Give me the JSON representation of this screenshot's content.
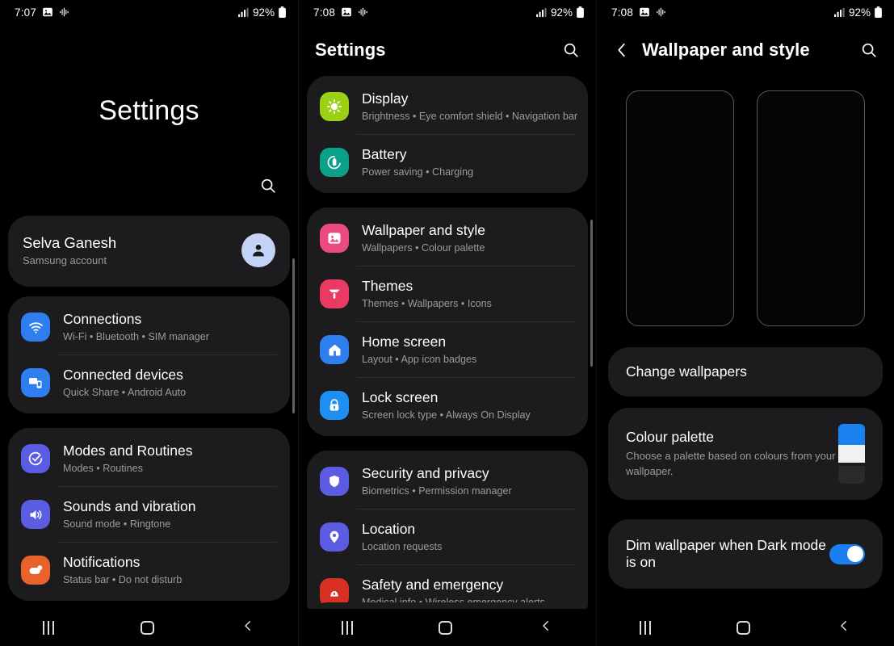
{
  "panels": {
    "one": {
      "status": {
        "time": "7:07",
        "battery": "92%",
        "icons": [
          "image-icon",
          "audio-wave-icon",
          "signal-bars-icon",
          "battery-icon"
        ]
      },
      "title": "Settings",
      "search_icon": "search-icon",
      "account": {
        "name": "Selva Ganesh",
        "subtitle": "Samsung account",
        "avatar": "person-avatar-icon"
      },
      "groups": [
        {
          "items": [
            {
              "title": "Connections",
              "subtitle": "Wi-Fi  •  Bluetooth  •  SIM manager",
              "icon": "wifi-icon",
              "color": "#2f7ef0"
            },
            {
              "title": "Connected devices",
              "subtitle": "Quick Share  •  Android Auto",
              "icon": "devices-icon",
              "color": "#2f7ef0"
            }
          ]
        },
        {
          "items": [
            {
              "title": "Modes and Routines",
              "subtitle": "Modes  •  Routines",
              "icon": "modes-check-icon",
              "color": "#5b5ce2"
            },
            {
              "title": "Sounds and vibration",
              "subtitle": "Sound mode  •  Ringtone",
              "icon": "speaker-icon",
              "color": "#5b5ce2"
            },
            {
              "title": "Notifications",
              "subtitle": "Status bar  •  Do not disturb",
              "icon": "notification-icon",
              "color": "#e8622c"
            }
          ]
        }
      ]
    },
    "two": {
      "status": {
        "time": "7:08",
        "battery": "92%"
      },
      "title": "Settings",
      "search_icon": "search-icon",
      "groups": [
        {
          "items": [
            {
              "title": "Display",
              "subtitle": "Brightness  •  Eye comfort shield  •  Navigation bar",
              "icon": "brightness-icon",
              "color": "#9bd014"
            },
            {
              "title": "Battery",
              "subtitle": "Power saving  •  Charging",
              "icon": "battery-circle-icon",
              "color": "#0ba188"
            }
          ]
        },
        {
          "items": [
            {
              "title": "Wallpaper and style",
              "subtitle": "Wallpapers  •  Colour palette",
              "icon": "picture-icon",
              "color": "#ec4a82"
            },
            {
              "title": "Themes",
              "subtitle": "Themes  •  Wallpapers  •  Icons",
              "icon": "paintbrush-icon",
              "color": "#e83a63"
            },
            {
              "title": "Home screen",
              "subtitle": "Layout  •  App icon badges",
              "icon": "home-icon",
              "color": "#2f7ef0"
            },
            {
              "title": "Lock screen",
              "subtitle": "Screen lock type  •  Always On Display",
              "icon": "lock-icon",
              "color": "#1f8ef1"
            }
          ]
        },
        {
          "items": [
            {
              "title": "Security and privacy",
              "subtitle": "Biometrics  •  Permission manager",
              "icon": "shield-icon",
              "color": "#5b5ce2"
            },
            {
              "title": "Location",
              "subtitle": "Location requests",
              "icon": "location-pin-icon",
              "color": "#5b5ce2"
            },
            {
              "title": "Safety and emergency",
              "subtitle": "Medical info  •  Wireless emergency alerts",
              "icon": "emergency-icon",
              "color": "#d93025"
            }
          ]
        }
      ]
    },
    "three": {
      "status": {
        "time": "7:08",
        "battery": "92%"
      },
      "back_icon": "back-chevron-icon",
      "title": "Wallpaper and style",
      "search_icon": "search-icon",
      "previews": [
        "home-screen-preview",
        "lock-screen-preview"
      ],
      "change_wallpapers": {
        "title": "Change wallpapers"
      },
      "colour_palette": {
        "title": "Colour palette",
        "subtitle": "Choose a palette based on colours from your wallpaper.",
        "swatch_colors": [
          "#1a82f0",
          "#f1f1f1",
          "#2a2a2c"
        ]
      },
      "dim_wallpaper": {
        "title": "Dim wallpaper when Dark mode is on",
        "enabled": true,
        "accent": "#1a7ff0"
      }
    }
  },
  "navbar": {
    "recents": "recents-icon",
    "home": "home-button-icon",
    "back": "back-button-icon"
  }
}
